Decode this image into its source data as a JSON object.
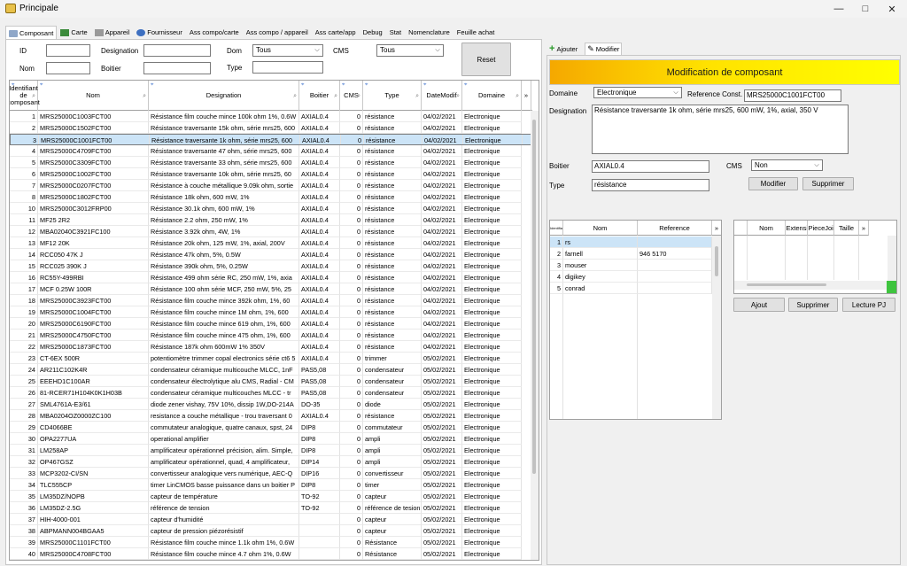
{
  "window": {
    "title": "Principale"
  },
  "tabs": [
    {
      "label": "Composant",
      "icon": "component-icon",
      "active": true
    },
    {
      "label": "Carte",
      "icon": "board-icon"
    },
    {
      "label": "Appareil",
      "icon": "device-icon"
    },
    {
      "label": "Fournisseur",
      "icon": "supplier-icon"
    },
    {
      "label": "Ass compo/carte"
    },
    {
      "label": "Ass compo / appareil"
    },
    {
      "label": "Ass carte/app"
    },
    {
      "label": "Debug"
    },
    {
      "label": "Stat"
    },
    {
      "label": "Nomenclature"
    },
    {
      "label": "Feuille achat"
    }
  ],
  "filters": {
    "id_label": "ID",
    "id_value": "",
    "nom_label": "Nom",
    "nom_value": "",
    "designation_label": "Designation",
    "designation_value": "",
    "boitier_label": "Boitier",
    "boitier_value": "",
    "dom_label": "Dom",
    "dom_value": "Tous",
    "cms_label": "CMS",
    "cms_value": "Tous",
    "type_label": "Type",
    "type_value": "",
    "reset_label": "Reset"
  },
  "grid": {
    "columns": [
      "Identifiant de composant",
      "Nom",
      "Designation",
      "Boitier",
      "CMS",
      "Type",
      "DateModif",
      "Domaine"
    ],
    "rows": [
      [
        "1",
        "MRS25000C1003FCT00",
        "Résistance film couche mince 100k ohm 1%, 0.6W",
        "AXIAL0.4",
        "0",
        "résistance",
        "04/02/2021",
        "Electronique"
      ],
      [
        "2",
        "MRS25000C1502FCT00",
        "Résistance traversante 15k ohm, série mrs25, 600",
        "AXIAL0.4",
        "0",
        "résistance",
        "04/02/2021",
        "Electronique"
      ],
      [
        "3",
        "MRS25000C1001FCT00",
        "Résistance traversante 1k ohm, série mrs25, 600",
        "AXIAL0.4",
        "0",
        "résistance",
        "04/02/2021",
        "Electronique"
      ],
      [
        "4",
        "MRS25000C4709FCT00",
        "Résistance traversante 47 ohm, série mrs25, 600",
        "AXIAL0.4",
        "0",
        "résistance",
        "04/02/2021",
        "Electronique"
      ],
      [
        "5",
        "MRS25000C3309FCT00",
        "Résistance traversante 33 ohm, série mrs25, 600",
        "AXIAL0.4",
        "0",
        "résistance",
        "04/02/2021",
        "Electronique"
      ],
      [
        "6",
        "MRS25000C1002FCT00",
        "Résistance traversante 10k ohm, série mrs25, 60",
        "AXIAL0.4",
        "0",
        "résistance",
        "04/02/2021",
        "Electronique"
      ],
      [
        "7",
        "MRS25000C0207FCT00",
        "Résistance à couche métallique 9.09k ohm, sortie",
        "AXIAL0.4",
        "0",
        "résistance",
        "04/02/2021",
        "Electronique"
      ],
      [
        "8",
        "MRS25000C1802FCT00",
        "Résistance 18k ohm, 600 mW, 1%",
        "AXIAL0.4",
        "0",
        "résistance",
        "04/02/2021",
        "Electronique"
      ],
      [
        "10",
        "MRS25000C3012FRP00",
        "Résistance 30.1k ohm, 600 mW, 1%",
        "AXIAL0.4",
        "0",
        "résistance",
        "04/02/2021",
        "Electronique"
      ],
      [
        "11",
        "MF25 2R2",
        "Résistance 2.2 ohm, 250 mW, 1%",
        "AXIAL0.4",
        "0",
        "résistance",
        "04/02/2021",
        "Electronique"
      ],
      [
        "12",
        "MBA02040C3921FC100",
        "Résistance 3.92k ohm, 4W, 1%",
        "AXIAL0.4",
        "0",
        "résistance",
        "04/02/2021",
        "Electronique"
      ],
      [
        "13",
        "MF12 20K",
        "Résistance 20k ohm, 125 mW, 1%, axial, 200V",
        "AXIAL0.4",
        "0",
        "résistance",
        "04/02/2021",
        "Electronique"
      ],
      [
        "14",
        "RCC050 47K J",
        "Résistance 47k ohm, 5%, 0.5W",
        "AXIAL0.4",
        "0",
        "résistance",
        "04/02/2021",
        "Electronique"
      ],
      [
        "15",
        "RCC025 390K J",
        "Résistance 390k ohm, 5%, 0.25W",
        "AXIAL0.4",
        "0",
        "résistance",
        "04/02/2021",
        "Electronique"
      ],
      [
        "16",
        "RC55Y-499RBI",
        "Résistance 499 ohm série RC, 250 mW, 1%, axia",
        "AXIAL0.4",
        "0",
        "résistance",
        "04/02/2021",
        "Electronique"
      ],
      [
        "17",
        "MCF 0.25W 100R",
        "Résistance 100 ohm série MCF, 250 mW, 5%, 25",
        "AXIAL0.4",
        "0",
        "résistance",
        "04/02/2021",
        "Electronique"
      ],
      [
        "18",
        "MRS25000C3923FCT00",
        "Résistance film couche mince 392k ohm, 1%, 60",
        "AXIAL0.4",
        "0",
        "résistance",
        "04/02/2021",
        "Electronique"
      ],
      [
        "19",
        "MRS25000C1004FCT00",
        "Résistance film couche mince 1M ohm, 1%, 600",
        "AXIAL0.4",
        "0",
        "résistance",
        "04/02/2021",
        "Electronique"
      ],
      [
        "20",
        "MRS25000C6190FCT00",
        "Résistance film couche mince 619 ohm, 1%, 600",
        "AXIAL0.4",
        "0",
        "résistance",
        "04/02/2021",
        "Electronique"
      ],
      [
        "21",
        "MRS25000C4750FCT00",
        "Résistance film couche mince 475 ohm, 1%, 600",
        "AXIAL0.4",
        "0",
        "résistance",
        "04/02/2021",
        "Electronique"
      ],
      [
        "22",
        "MRS25000C1873FCT00",
        "Résistance 187k ohm 600mW 1% 350V",
        "AXIAL0.4",
        "0",
        "résistance",
        "04/02/2021",
        "Electronique"
      ],
      [
        "23",
        "CT-6EX 500R",
        "potentiomètre trimmer copal electronics série ct6 5",
        "AXIAL0.4",
        "0",
        "trimmer",
        "05/02/2021",
        "Electronique"
      ],
      [
        "24",
        "AR211C102K4R",
        "condensateur céramique multicouche MLCC, 1nF",
        "PAS5,08",
        "0",
        "condensateur",
        "05/02/2021",
        "Electronique"
      ],
      [
        "25",
        "EEEHD1C100AR",
        "condensateur électrolytique alu CMS, Radial - CM",
        "PAS5,08",
        "0",
        "condensateur",
        "05/02/2021",
        "Electronique"
      ],
      [
        "26",
        "81-RCER71H104K0K1H03B",
        "condensateur céramique multicouches MLCC - tr",
        "PAS5,08",
        "0",
        "condensateur",
        "05/02/2021",
        "Electronique"
      ],
      [
        "27",
        "SML4761A-E3/61",
        "diode zener vishay, 75V 10%, dissip 1W,DO-214A",
        "DO-35",
        "0",
        "diode",
        "05/02/2021",
        "Electronique"
      ],
      [
        "28",
        "MBA0204OZ0000ZC100",
        "resistance a couche métallique - trou traversant 0",
        "AXIAL0.4",
        "0",
        "résistance",
        "05/02/2021",
        "Electronique"
      ],
      [
        "29",
        "CD4066BE",
        "commutateur analogique, quatre canaux, spst, 24",
        "DIP8",
        "0",
        "commutateur",
        "05/02/2021",
        "Electronique"
      ],
      [
        "30",
        "OPA2277UA",
        "operational amplifier",
        "DIP8",
        "0",
        "ampli",
        "05/02/2021",
        "Electronique"
      ],
      [
        "31",
        "LM258AP",
        "amplificateur opérationnel précision, alim. Simple,",
        "DIP8",
        "0",
        "ampli",
        "05/02/2021",
        "Electronique"
      ],
      [
        "32",
        "OP467GSZ",
        "amplificateur opérationnel, quad, 4 amplificateur,",
        "DIP14",
        "0",
        "ampli",
        "05/02/2021",
        "Electronique"
      ],
      [
        "33",
        "MCP3202-CI/SN",
        "convertisseur analogique vers numérique, AEC-Q",
        "DIP16",
        "0",
        "convertisseur",
        "05/02/2021",
        "Electronique"
      ],
      [
        "34",
        "TLC555CP",
        "timer LinCMOS basse puissance dans un boitier P",
        "DIP8",
        "0",
        "timer",
        "05/02/2021",
        "Electronique"
      ],
      [
        "35",
        "LM35DZ/NOPB",
        "capteur de température",
        "TO-92",
        "0",
        "capteur",
        "05/02/2021",
        "Electronique"
      ],
      [
        "36",
        "LM35DZ-2.5G",
        "référence de tension",
        "TO-92",
        "0",
        "référence de tesion",
        "05/02/2021",
        "Electronique"
      ],
      [
        "37",
        "HIH-4000-001",
        "capteur d'humidité",
        "",
        "0",
        "capteur",
        "05/02/2021",
        "Electronique"
      ],
      [
        "38",
        "ABPMANN004BGAA5",
        "capteur de pression piézorésistif",
        "",
        "0",
        "capteur",
        "05/02/2021",
        "Electronique"
      ],
      [
        "39",
        "MRS25000C1101FCT00",
        "Résistance film couche mince 1.1k ohm 1%, 0.6W",
        "",
        "0",
        "Résistance",
        "05/02/2021",
        "Electronique"
      ],
      [
        "40",
        "MRS25000C4708FCT00",
        "Résistance film couche mince 4.7 ohm 1%, 0.6W",
        "",
        "0",
        "Résistance",
        "05/02/2021",
        "Electronique"
      ]
    ],
    "selected_row": 2
  },
  "right_tabs": [
    {
      "label": "Ajouter",
      "icon": "plus-icon"
    },
    {
      "label": "Modifier",
      "icon": "pencil-icon",
      "active": true
    }
  ],
  "edit_panel": {
    "banner": "Modification de composant",
    "domaine_label": "Domaine",
    "domaine_value": "Electronique",
    "ref_label": "Reference Const.",
    "ref_value": "MRS25000C1001FCT00",
    "designation_label": "Designation",
    "designation_value": "Résistance traversante 1k ohm, série mrs25, 600 mW, 1%, axial, 350 V",
    "boitier_label": "Boitier",
    "boitier_value": "AXIAL0.4",
    "cms_label": "CMS",
    "cms_value": "Non",
    "type_label": "Type",
    "type_value": "résistance",
    "modifier_label": "Modifier",
    "supprimer_label": "Supprimer"
  },
  "supplier_grid": {
    "columns": [
      "Identifiant de",
      "Nom",
      "Reference"
    ],
    "rows": [
      [
        "1",
        "rs",
        ""
      ],
      [
        "2",
        "farnell",
        "946 5170"
      ],
      [
        "3",
        "mouser",
        ""
      ],
      [
        "4",
        "digikey",
        ""
      ],
      [
        "5",
        "conrad",
        ""
      ]
    ]
  },
  "file_grid": {
    "columns": [
      "Nom",
      "Extension",
      "PieceJointe",
      "Taille"
    ]
  },
  "file_buttons": {
    "ajout": "Ajout",
    "supprimer": "Supprimer",
    "lecture": "Lecture PJ"
  },
  "colors": {
    "banner_start": "#f5a800",
    "banner_end": "#ffff00",
    "selection": "#cce4f7"
  }
}
